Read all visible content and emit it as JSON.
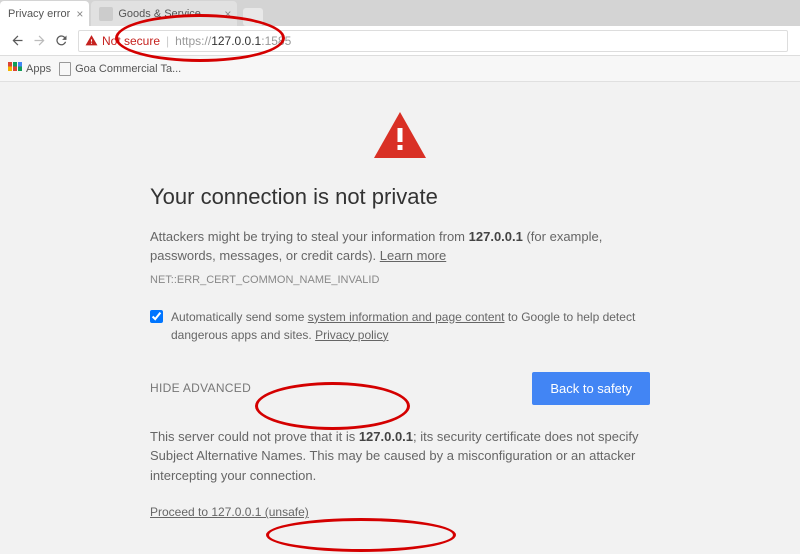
{
  "tabs": [
    {
      "title": "Privacy error",
      "active": true
    },
    {
      "title": "Goods & Service Tax (GS",
      "active": false
    }
  ],
  "toolbar": {
    "not_secure_label": "Not secure",
    "url_scheme": "https",
    "url_host": "127.0.0.1",
    "url_port": ":1585"
  },
  "bookmarks": {
    "apps_label": "Apps",
    "item1_label": "Goa Commercial Ta..."
  },
  "page": {
    "heading": "Your connection is not private",
    "intro_prefix": "Attackers might be trying to steal your information from ",
    "intro_host": "127.0.0.1",
    "intro_suffix": " (for example, passwords, messages, or credit cards). ",
    "learn_more": "Learn more",
    "error_code": "NET::ERR_CERT_COMMON_NAME_INVALID",
    "checkbox_prefix": "Automatically send some ",
    "checkbox_link1": "system information and page content",
    "checkbox_middle": " to Google to help detect dangerous apps and sites. ",
    "checkbox_link2": "Privacy policy",
    "hide_advanced_label": "HIDE ADVANCED",
    "back_to_safety_label": "Back to safety",
    "adv_prefix": "This server could not prove that it is ",
    "adv_host": "127.0.0.1",
    "adv_suffix": "; its security certificate does not specify Subject Alternative Names. This may be caused by a misconfiguration or an attacker intercepting your connection.",
    "proceed_label": "Proceed to 127.0.0.1 (unsafe)"
  }
}
